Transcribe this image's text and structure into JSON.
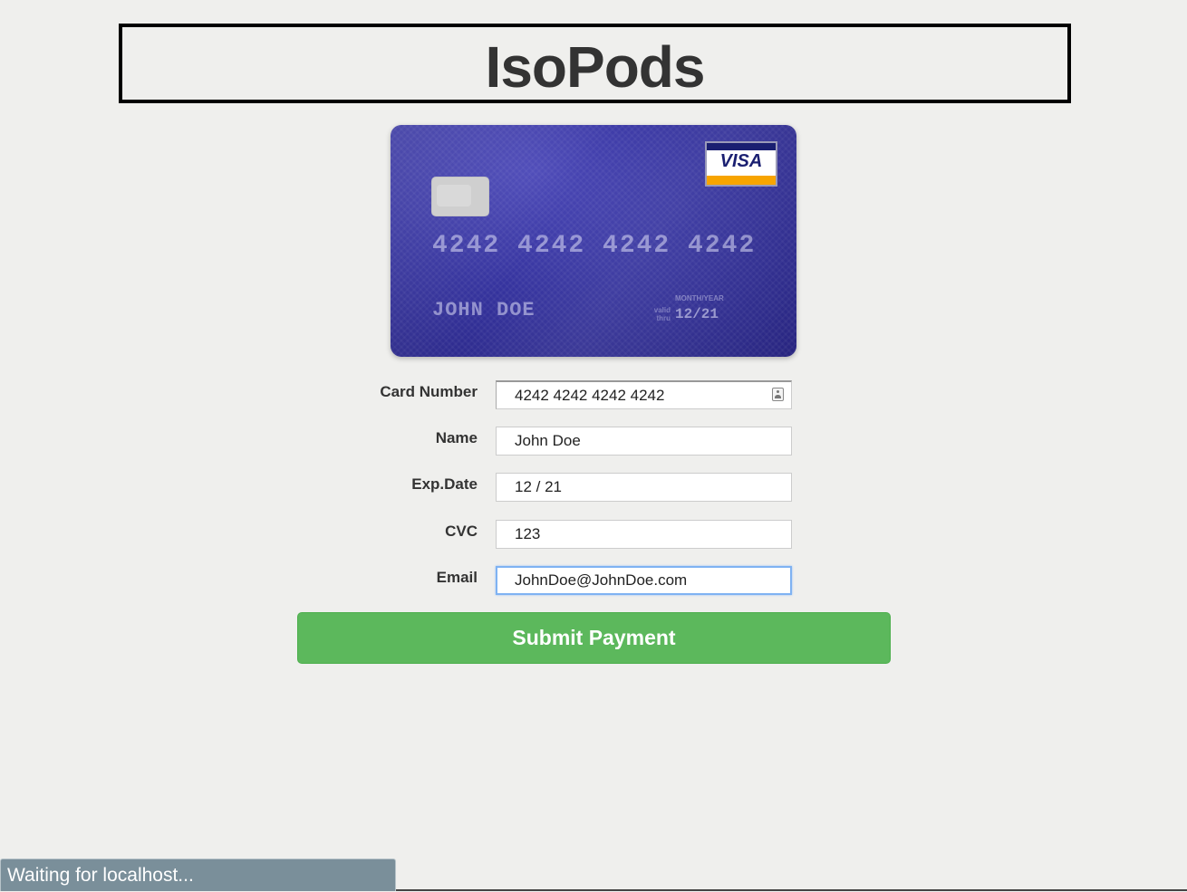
{
  "header": {
    "title": "IsoPods"
  },
  "card_preview": {
    "number": "4242 4242 4242 4242",
    "name": "JOHN DOE",
    "valid_thru": "valid thru",
    "month_year_label": "MONTH/YEAR",
    "expiry": "12/21",
    "brand": "VISA",
    "colors": {
      "card_base": "#35339e",
      "visa_blue": "#1a1f71",
      "visa_gold": "#f7a400"
    }
  },
  "form": {
    "card_number": {
      "label": "Card Number",
      "value": "4242 4242 4242 4242",
      "icon": "contact-card-icon"
    },
    "name": {
      "label": "Name",
      "value": "John Doe"
    },
    "exp_date": {
      "label": "Exp.Date",
      "value": "12 / 21"
    },
    "cvc": {
      "label": "CVC",
      "value": "123"
    },
    "email": {
      "label": "Email",
      "value": "JohnDoe@JohnDoe.com"
    },
    "submit_label": "Submit Payment"
  },
  "status_bar": {
    "text": "Waiting for localhost..."
  },
  "colors": {
    "page_background": "#efefed",
    "submit_button": "#5cb85c",
    "focus_ring": "#7fb2f2",
    "status_bar": "#7a8f9a"
  }
}
